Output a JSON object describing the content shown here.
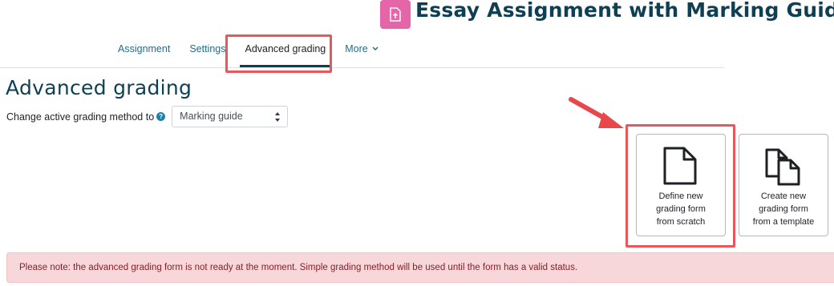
{
  "header": {
    "title": "Essay Assignment with Marking Guide",
    "activity_icon": "assignment-upload-icon",
    "icon_color": "#e566a8"
  },
  "nav": {
    "items": [
      "Assignment",
      "Settings",
      "Advanced grading"
    ],
    "more_label": "More",
    "active": "Advanced grading"
  },
  "content": {
    "heading": "Advanced grading",
    "method_label": "Change active grading method to",
    "method_selected": "Marking guide"
  },
  "cards": [
    {
      "label": "Define new grading form from scratch",
      "icon": "blank-document-icon"
    },
    {
      "label": "Create new grading form from a template",
      "icon": "copy-documents-icon"
    }
  ],
  "notice": "Please note: the advanced grading form is not ready at the moment. Simple grading method will be used until the form has a valid status.",
  "colors": {
    "accent": "#0f3f52",
    "link": "#1f6f8b",
    "highlight": "#e8575b",
    "notice_bg": "#f8d7da"
  }
}
